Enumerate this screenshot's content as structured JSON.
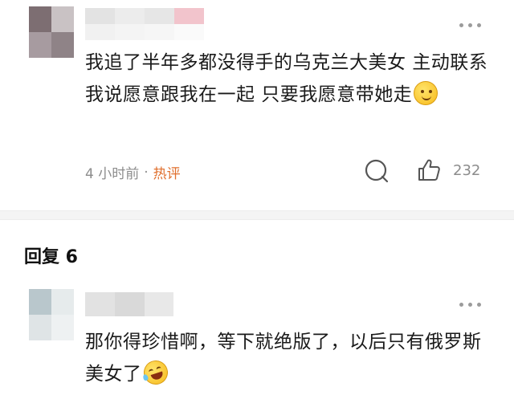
{
  "colors": {
    "hot_accent": "#e0702f",
    "meta_gray": "#8c8c8c",
    "divider": "#f4f4f4"
  },
  "comment_1": {
    "text_parts": [
      "我追了半年多都没得手的乌克兰大美女 主动联系我说愿意跟我在一起 只要我愿意带她走"
    ],
    "emoji": "smile-emoji",
    "time": "4 小时前",
    "separator": "·",
    "tag": "热评",
    "like_count": "232",
    "icons": [
      "more-icon",
      "comment-icon",
      "like-icon"
    ]
  },
  "reply_section": {
    "heading": "回复 6"
  },
  "comment_2": {
    "text_parts": [
      "那你得珍惜啊，等下就绝版了，以后只有俄罗斯美女了"
    ],
    "emoji": "laughing-tears-emoji",
    "icons": [
      "more-icon"
    ]
  }
}
